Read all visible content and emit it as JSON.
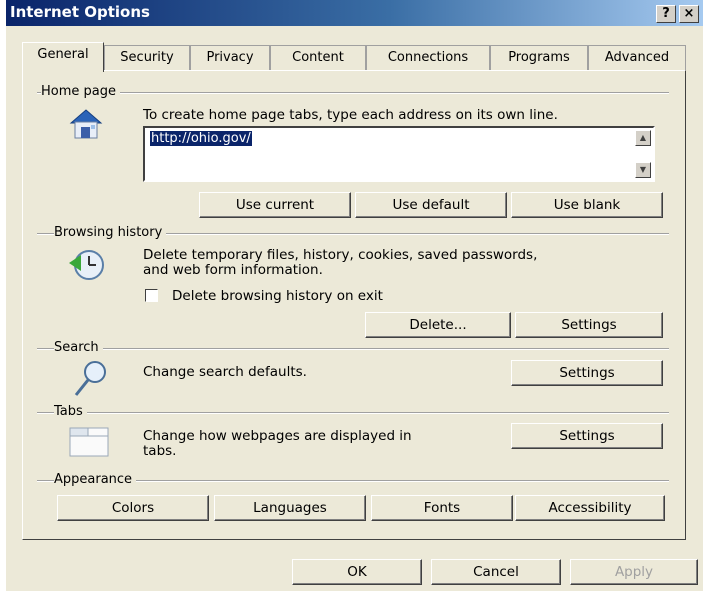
{
  "window": {
    "title": "Internet Options",
    "help_button": "?",
    "close_button": "×"
  },
  "tabs": [
    {
      "label": "General"
    },
    {
      "label": "Security"
    },
    {
      "label": "Privacy"
    },
    {
      "label": "Content"
    },
    {
      "label": "Connections"
    },
    {
      "label": "Programs"
    },
    {
      "label": "Advanced"
    }
  ],
  "home_page": {
    "group_label": "Home page",
    "instruction": "To create home page tabs, type each address on its own line.",
    "url": "http://ohio.gov/",
    "use_current": "Use current",
    "use_default": "Use default",
    "use_blank": "Use blank"
  },
  "browsing_history": {
    "group_label": "Browsing history",
    "description_line1": "Delete temporary files, history, cookies, saved passwords,",
    "description_line2": "and web form information.",
    "checkbox_label": "Delete browsing history on exit",
    "delete_button": "Delete...",
    "settings_button": "Settings"
  },
  "search": {
    "group_label": "Search",
    "description": "Change search defaults.",
    "settings_button": "Settings"
  },
  "tabs_section": {
    "group_label": "Tabs",
    "description_line1": "Change how webpages are displayed in",
    "description_line2": "tabs.",
    "settings_button": "Settings"
  },
  "appearance": {
    "group_label": "Appearance",
    "colors": "Colors",
    "languages": "Languages",
    "fonts": "Fonts",
    "accessibility": "Accessibility"
  },
  "footer": {
    "ok": "OK",
    "cancel": "Cancel",
    "apply": "Apply"
  }
}
